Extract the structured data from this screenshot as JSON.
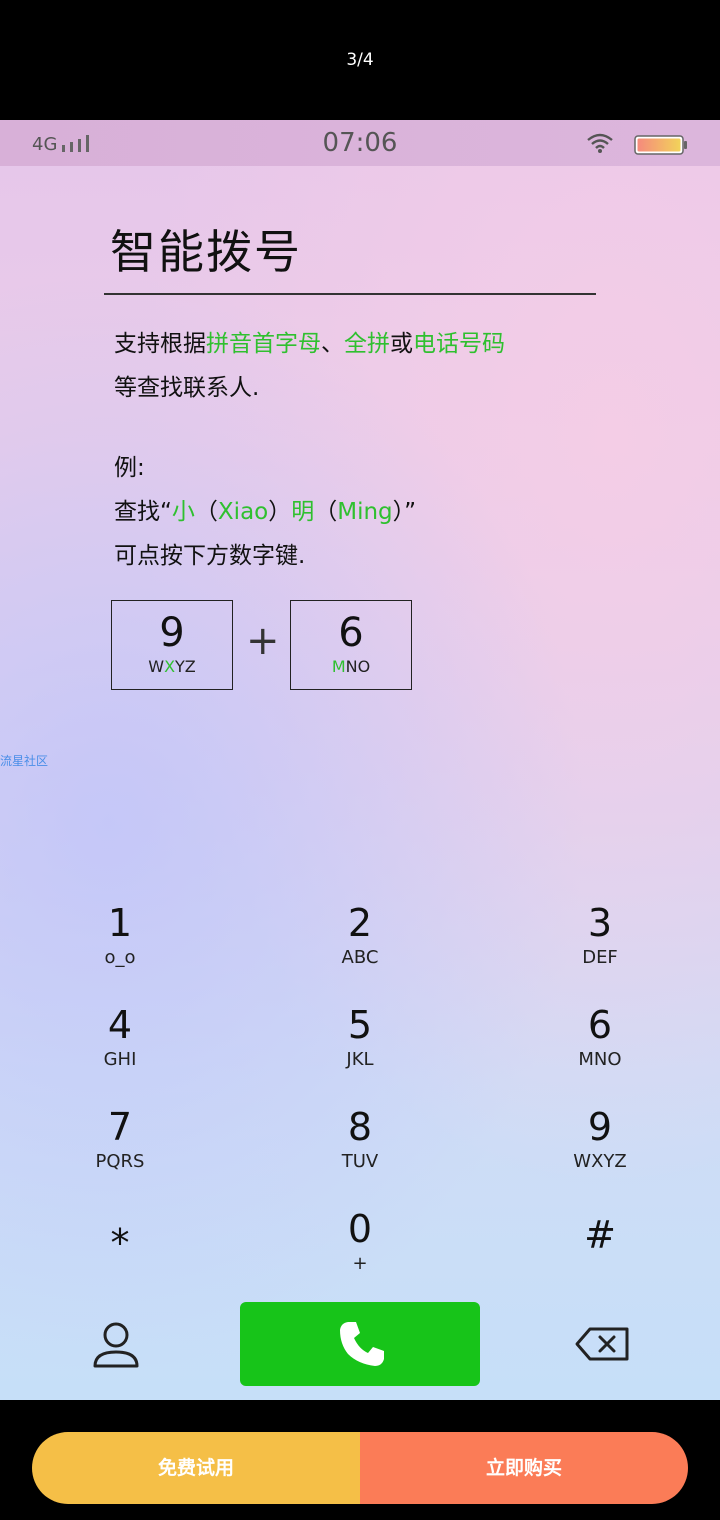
{
  "viewer": {
    "page_indicator": "3/4"
  },
  "status_bar": {
    "network": "4G",
    "time": "07:06",
    "icons": [
      "signal-icon",
      "wifi-icon",
      "battery-icon"
    ]
  },
  "guide": {
    "title": "智能拨号",
    "desc_line1_parts": [
      "支持根据",
      "拼音首字母",
      "、",
      "全拼",
      "或",
      "电话号码"
    ],
    "desc_line2": "等查找联系人.",
    "example_label": "例:",
    "example_line2_parts": [
      "查找“",
      "小",
      "（",
      "Xiao",
      "）",
      "明",
      "（",
      "Ming",
      "）”"
    ],
    "example_line3": "可点按下方数字键.",
    "key_a": {
      "digit": "9",
      "letters_pre": "W",
      "letters_hl": "X",
      "letters_post": "YZ"
    },
    "key_b": {
      "digit": "6",
      "letters_pre": "",
      "letters_hl": "M",
      "letters_post": "NO"
    },
    "plus": "+",
    "accent_color": "#2fc02f"
  },
  "watermark": "流星社区",
  "keypad": {
    "keys": [
      {
        "num": "1",
        "letters": "o_o"
      },
      {
        "num": "2",
        "letters": "ABC"
      },
      {
        "num": "3",
        "letters": "DEF"
      },
      {
        "num": "4",
        "letters": "GHI"
      },
      {
        "num": "5",
        "letters": "JKL"
      },
      {
        "num": "6",
        "letters": "MNO"
      },
      {
        "num": "7",
        "letters": "PQRS"
      },
      {
        "num": "8",
        "letters": "TUV"
      },
      {
        "num": "9",
        "letters": "WXYZ"
      },
      {
        "num": "*",
        "letters": ""
      },
      {
        "num": "0",
        "letters": "+"
      },
      {
        "num": "#",
        "letters": ""
      }
    ]
  },
  "actions": {
    "icons": [
      "contacts-icon",
      "phone-icon",
      "backspace-icon"
    ],
    "call_color": "#17c419"
  },
  "purchase": {
    "trial_label": "免费试用",
    "buy_label": "立即购买",
    "trial_color": "#f5bf47",
    "buy_color": "#fb7c57"
  }
}
